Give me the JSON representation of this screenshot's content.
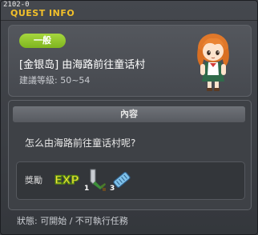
{
  "window": {
    "id_label": "2102-0",
    "title": "QUEST INFO"
  },
  "quest": {
    "category": "一般",
    "name": "[金银岛] 由海路前往童话村",
    "level_text": "建議等級: 50~54",
    "npc": "npc-portrait"
  },
  "content": {
    "header": "內容",
    "text": "怎么由海路前往童话村呢?"
  },
  "rewards": {
    "label": "獎勵",
    "exp_text": "EXP",
    "items": [
      {
        "icon": "sword-icon",
        "count": "1"
      },
      {
        "icon": "scroll-icon",
        "count": "3"
      }
    ]
  },
  "status": {
    "text": "狀態: 可開始 / 不可執行任務"
  },
  "colors": {
    "title": "#f2c02a",
    "badge": "#8cc427",
    "exp_green": "#8fd11a",
    "exp_yellow": "#f2e23a"
  }
}
